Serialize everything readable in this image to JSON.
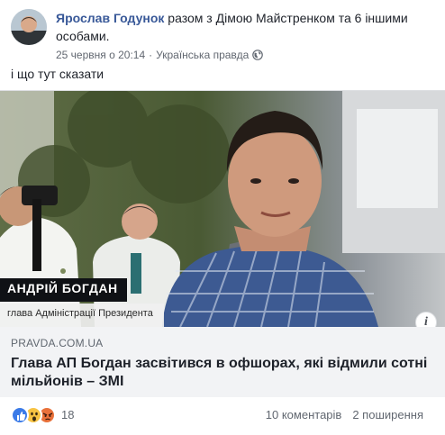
{
  "post": {
    "author": "Ярослав Годунок",
    "with_text": " разом з Дімою Майстренком та 6 іншими особами.",
    "date": "25 червня о 20:14",
    "source": "Українська правда",
    "text": "і що тут сказати"
  },
  "link": {
    "image": {
      "caption_name": "АНДРІЙ БОГДАН",
      "caption_role": "глава Адміністрації Президента"
    },
    "domain": "PRAVDA.COM.UA",
    "title": "Глава АП Богдан засвітився в офшорах, які відмили сотні мільйонів – ЗМІ"
  },
  "footer": {
    "reaction_icons": [
      "like-icon",
      "wow-icon",
      "angry-icon"
    ],
    "reaction_count": "18",
    "comments": "10 коментарів",
    "shares": "2 поширення"
  },
  "colors": {
    "author_link": "#385898",
    "meta_text": "#616770",
    "card_bg": "#f2f3f5",
    "like": "#3b7be8",
    "wow": "#f7c342",
    "angry": "#e9713a"
  }
}
